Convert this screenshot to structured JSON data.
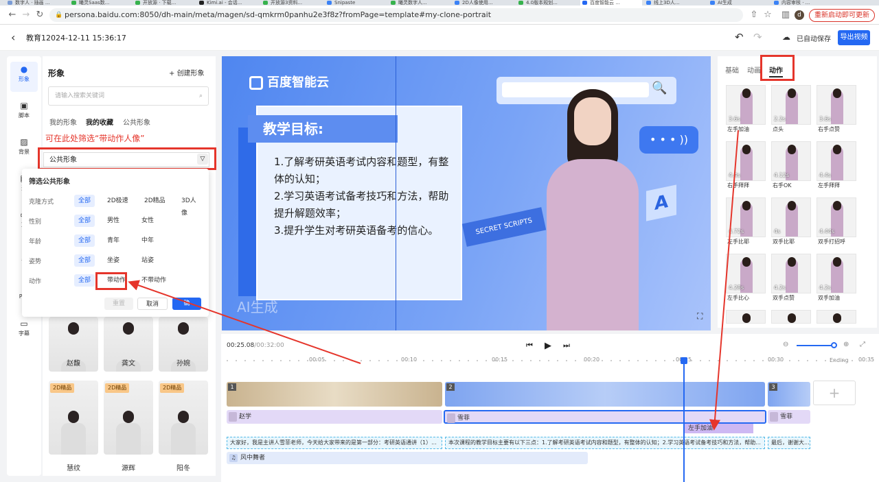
{
  "browser": {
    "tabs": [
      {
        "label": "数字人 · 插画 ...",
        "color": "#7b9cd6"
      },
      {
        "label": "曦灵Saas数...",
        "color": "#37b24d"
      },
      {
        "label": "开放源 · 下载...",
        "color": "#37b24d"
      },
      {
        "label": "Kimi.ai - 会话...",
        "color": "#222222"
      },
      {
        "label": "开放源3资料...",
        "color": "#37b24d"
      },
      {
        "label": "Snipaste",
        "color": "#3b82f6"
      },
      {
        "label": "曦灵数字人...",
        "color": "#37b24d"
      },
      {
        "label": "2D人像使用...",
        "color": "#3b82f6"
      },
      {
        "label": "4.0版本规划...",
        "color": "#37b24d"
      },
      {
        "label": "百度智能云 ...",
        "color": "#2468f2"
      },
      {
        "label": "线上3D人...",
        "color": "#3b82f6"
      },
      {
        "label": "AI生成",
        "color": "#3b82f6"
      },
      {
        "label": "内容审核 · ...",
        "color": "#3b82f6"
      }
    ],
    "url": "persona.baidu.com:8050/dh-main/meta/magen/sd-qmkrm0panhu2e3f8z?fromPage=template#my-clone-portrait",
    "restart_label": "重新启动即可更新",
    "profile_initial": "d"
  },
  "header": {
    "title": "教育12024-12-11 15:36:17",
    "autosave": "已自动保存",
    "export": "导出视频"
  },
  "leftnav": [
    {
      "label": "形象",
      "icon": "avatar-icon"
    },
    {
      "label": "脚本",
      "icon": "script-icon"
    },
    {
      "label": "背景",
      "icon": "background-icon"
    },
    {
      "label": "素",
      "icon": "material-icon"
    },
    {
      "label": "文",
      "icon": "text-icon"
    },
    {
      "label": "音",
      "icon": "audio-icon"
    },
    {
      "label": "PPT",
      "icon": "ppt-icon"
    },
    {
      "label": "字幕",
      "icon": "subtitle-icon"
    }
  ],
  "panel": {
    "title": "形象",
    "create": "创建形象",
    "search_placeholder": "请输入搜索关键词",
    "tabs": [
      "我的形象",
      "我的收藏",
      "公共形象"
    ],
    "annotation": "可在此处筛选“带动作人像”",
    "filter_value": "公共形象"
  },
  "popup": {
    "title": "筛选公共形象",
    "rows": [
      {
        "label": "克隆方式",
        "options": [
          "全部",
          "2D极速",
          "2D精品",
          "3D人像"
        ]
      },
      {
        "label": "性别",
        "options": [
          "全部",
          "男性",
          "女性"
        ]
      },
      {
        "label": "年龄",
        "options": [
          "全部",
          "青年",
          "中年"
        ]
      },
      {
        "label": "姿势",
        "options": [
          "全部",
          "坐姿",
          "站姿"
        ]
      },
      {
        "label": "动作",
        "options": [
          "全部",
          "带动作",
          "不带动作"
        ]
      }
    ],
    "reset": "重置",
    "cancel": "取消",
    "confirm": "确"
  },
  "avatars": [
    {
      "name": "赵馥",
      "badge": ""
    },
    {
      "name": "龚文",
      "badge": ""
    },
    {
      "name": "孙婉",
      "badge": ""
    },
    {
      "name": "慧纹",
      "badge": "2D精品"
    },
    {
      "name": "源辉",
      "badge": "2D精品"
    },
    {
      "name": "阳冬",
      "badge": "2D精品"
    }
  ],
  "canvas": {
    "logo": "百度智能云",
    "heading": "教学目标:",
    "body": "1.了解考研英语考试内容和题型，有整体的认知；\n2.学习英语考试备考技巧和方法，帮助提升解题效率；\n3.提升学生对考研英语备考的信心。",
    "scripts_label": "SECRET SCRIPTS",
    "bubble": "• • • ))",
    "letter": "A",
    "watermark": "AI生成"
  },
  "right": {
    "tabs": [
      "基础",
      "动画",
      "动作"
    ],
    "motions": [
      {
        "label": "左手加油",
        "dur": "3.6s"
      },
      {
        "label": "点头",
        "dur": "2.2s"
      },
      {
        "label": "右手点赞",
        "dur": "3.6s"
      },
      {
        "label": "右手拜拜",
        "dur": "4.4s"
      },
      {
        "label": "右手OK",
        "dur": "4.12s"
      },
      {
        "label": "左手拜拜",
        "dur": "4.4s"
      },
      {
        "label": "左手比耶",
        "dur": "4.72s"
      },
      {
        "label": "双手比耶",
        "dur": "4s"
      },
      {
        "label": "双手打招呼",
        "dur": "4.44s"
      },
      {
        "label": "左手比心",
        "dur": "4.28s"
      },
      {
        "label": "双手点赞",
        "dur": "4.2s"
      },
      {
        "label": "双手加油",
        "dur": "4.2s"
      }
    ]
  },
  "timeline": {
    "current": "00:25.08",
    "total": "/00:32:00",
    "ticks": [
      "00:05",
      "00:10",
      "00:15",
      "00:20",
      "00:25",
      "00:30",
      "00:35"
    ],
    "ending": "Ending",
    "clip_numbers": [
      "1",
      "2",
      "3"
    ],
    "tracks": [
      "赵学",
      "雪菲",
      "雪菲"
    ],
    "action_clip": "左手加油",
    "subtitles": [
      "大家好，我是主讲人雪菲老师，今天给大家带来的是第一部分：考研英语通讲（1）...",
      "本次课程的教学目标主要有以下三点：1.了解考研英语考试内容和题型，有整体的认知；2.学习英语考试备考技巧和方法，帮助...",
      "最后，谢谢大..."
    ],
    "music": "风中舞者"
  },
  "colors": {
    "accent": "#2468f2",
    "annotation": "#e5352b"
  }
}
